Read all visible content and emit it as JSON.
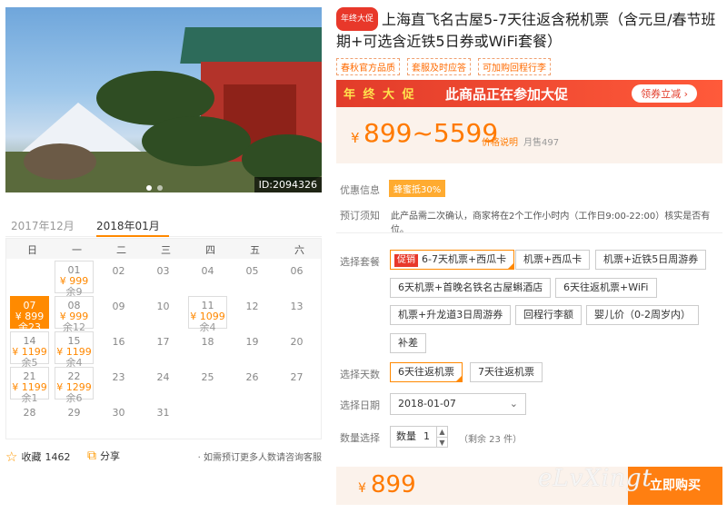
{
  "hero": {
    "image_id": "ID:2094326"
  },
  "calendar": {
    "tabs": [
      "2017年12月",
      "2018年01月"
    ],
    "weekdays": [
      "日",
      "一",
      "二",
      "三",
      "四",
      "五",
      "六"
    ],
    "days": [
      {
        "d": "01",
        "price": "¥ 999",
        "rem": "余9"
      },
      {
        "d": "02"
      },
      {
        "d": "03"
      },
      {
        "d": "04"
      },
      {
        "d": "05"
      },
      {
        "d": "06"
      },
      {
        "d": "07",
        "price": "¥ 899",
        "rem": "余23"
      },
      {
        "d": "08",
        "price": "¥ 999",
        "rem": "余12"
      },
      {
        "d": "09"
      },
      {
        "d": "10"
      },
      {
        "d": "11",
        "price": "¥ 1099",
        "rem": "余4"
      },
      {
        "d": "12"
      },
      {
        "d": "13"
      },
      {
        "d": "14",
        "price": "¥ 1199",
        "rem": "余5"
      },
      {
        "d": "15",
        "price": "¥ 1199",
        "rem": "余4"
      },
      {
        "d": "16"
      },
      {
        "d": "17"
      },
      {
        "d": "18"
      },
      {
        "d": "19"
      },
      {
        "d": "20"
      },
      {
        "d": "21",
        "price": "¥ 1199",
        "rem": "余1"
      },
      {
        "d": "22",
        "price": "¥ 1299",
        "rem": "余6"
      },
      {
        "d": "23"
      },
      {
        "d": "24"
      },
      {
        "d": "25"
      },
      {
        "d": "26"
      },
      {
        "d": "27"
      },
      {
        "d": "28"
      },
      {
        "d": "29"
      },
      {
        "d": "30"
      },
      {
        "d": "31"
      }
    ]
  },
  "footer_left": {
    "fav_label": "收藏",
    "fav_count": "1462",
    "share_label": "分享",
    "consult": "· 如需预订更多人数请咨询客服"
  },
  "product": {
    "badge": "年终大促",
    "title": "上海直飞名古屋5-7天往返含税机票（含元旦/春节班期+可选含近铁5日券或WiFi套餐）",
    "tags": [
      "春秋官方品质",
      "套服及时应答",
      "可加购回程行李"
    ]
  },
  "promo": {
    "year_label": "年 终 大 促",
    "message": "此商品正在参加大促",
    "coupon": "领券立减 ›"
  },
  "price": {
    "yen": "¥",
    "range": "899~5599",
    "note": "价格说明",
    "sold": "月售497"
  },
  "info": {
    "discount_label": "优惠信息",
    "discount_badge": "蜂蜜抵30%",
    "notice_label": "预订须知",
    "notice": "此产品需二次确认，商家将在2个工作小时内（工作日9:00-22:00）核实是否有位。"
  },
  "packages": {
    "label": "选择套餐",
    "hot": "促销",
    "options": [
      "6-7天机票+西瓜卡",
      "机票+西瓜卡",
      "机票+近铁5日周游券",
      "6天机票+首晚名铁名古屋蝌酒店",
      "6天往返机票+WiFi",
      "机票+升龙道3日周游券",
      "回程行李额",
      "婴儿价（0-2周岁内）",
      "补差"
    ]
  },
  "days_opt": {
    "label": "选择天数",
    "options": [
      "6天往返机票",
      "7天往返机票"
    ]
  },
  "date_opt": {
    "label": "选择日期",
    "value": "2018-01-07"
  },
  "qty": {
    "label": "数量选择",
    "box_label": "数量",
    "value": "1",
    "stock": "（剩余 23 件）"
  },
  "bottom": {
    "yen": "¥",
    "final": "899",
    "buy": "立即购买"
  },
  "watermark": "eLvXingt"
}
